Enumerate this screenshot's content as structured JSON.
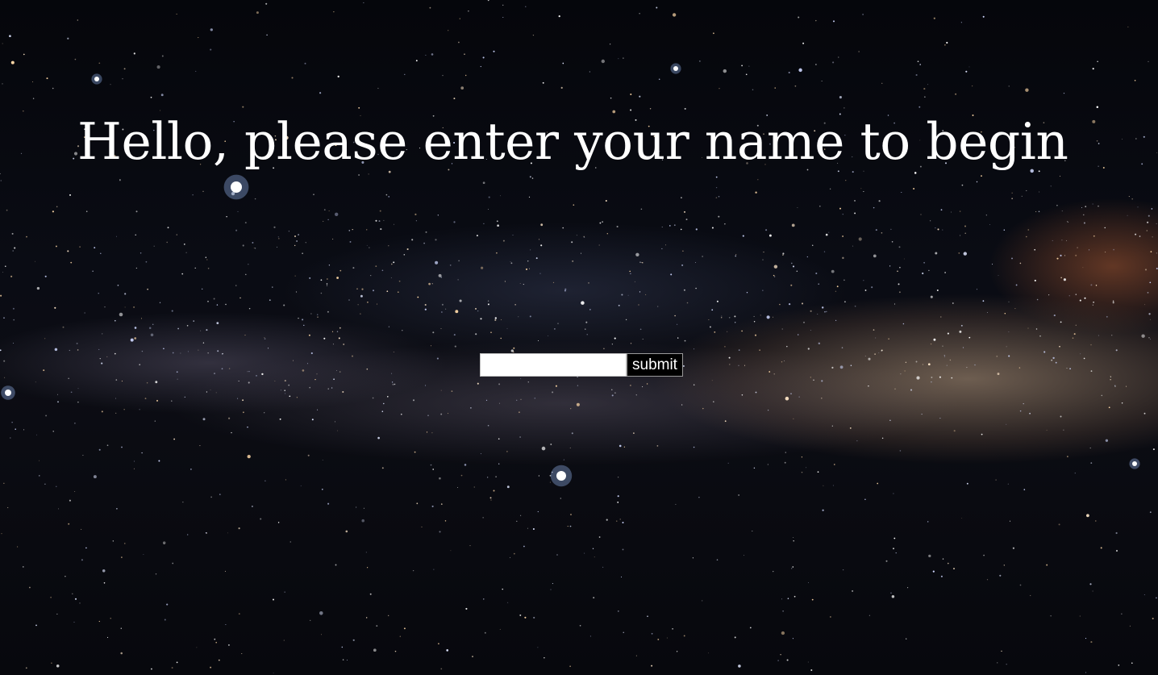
{
  "page": {
    "background": "starry night sky with milky way",
    "headline": "Hello, please enter your name to begin"
  },
  "form": {
    "name_value": "",
    "name_placeholder": "",
    "submit_label": "submit"
  },
  "colors": {
    "headline_text": "#ffffff",
    "input_background": "#ffffff",
    "button_background": "#000000",
    "button_text": "#ffffff"
  }
}
